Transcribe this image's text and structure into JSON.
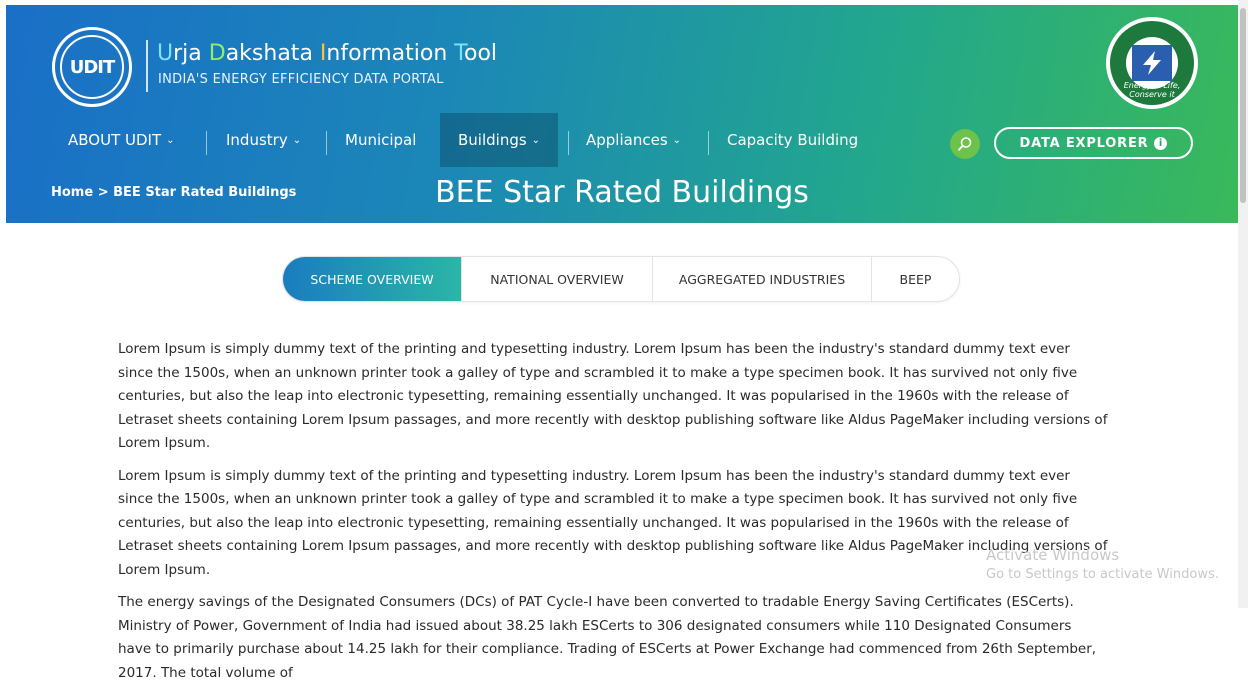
{
  "brand": {
    "logo_text": "UDIT",
    "title_parts": [
      {
        "cap": "U",
        "rest": "rja "
      },
      {
        "cap": "D",
        "rest": "akshata "
      },
      {
        "cap": "I",
        "rest": "nformation "
      },
      {
        "cap": "T",
        "rest": "ool"
      }
    ],
    "subtitle": "INDIA'S ENERGY EFFICIENCY DATA PORTAL",
    "bee_logo_text": "Energy is Life, Conserve it"
  },
  "nav": {
    "items": [
      {
        "label": "ABOUT UDIT",
        "dropdown": true
      },
      {
        "label": "Industry",
        "dropdown": true
      },
      {
        "label": "Municipal",
        "dropdown": false
      },
      {
        "label": "Buildings",
        "dropdown": true
      },
      {
        "label": "Appliances",
        "dropdown": true
      },
      {
        "label": "Capacity Building",
        "dropdown": false
      }
    ],
    "search_icon": "search-icon",
    "explorer_label": "DATA EXPLORER"
  },
  "breadcrumb": "Home > BEE Star Rated Buildings",
  "page_title": "BEE Star Rated Buildings",
  "tabs": [
    {
      "label": "SCHEME OVERVIEW",
      "active": true
    },
    {
      "label": "NATIONAL OVERVIEW",
      "active": false
    },
    {
      "label": "AGGREGATED INDUSTRIES",
      "active": false
    },
    {
      "label": "BEEP",
      "active": false
    }
  ],
  "paragraphs": [
    "Lorem Ipsum is simply dummy text of the printing and typesetting industry. Lorem Ipsum has been the industry's standard dummy text ever since the 1500s, when an unknown printer took a galley of type and scrambled it to make a type specimen book. It has survived not only five centuries, but also the leap into electronic typesetting, remaining essentially unchanged. It was popularised in the 1960s with the release of Letraset sheets containing Lorem Ipsum passages, and more recently with desktop publishing software like Aldus PageMaker including versions of Lorem Ipsum.",
    "Lorem Ipsum is simply dummy text of the printing and typesetting industry. Lorem Ipsum has been the industry's standard dummy text ever since the 1500s, when an unknown printer took a galley of type and scrambled it to make a type specimen book. It has survived not only five centuries, but also the leap into electronic typesetting, remaining essentially unchanged. It was popularised in the 1960s with the release of Letraset sheets containing Lorem Ipsum passages, and more recently with desktop publishing software like Aldus PageMaker including versions of Lorem Ipsum.",
    "The energy savings of the Designated Consumers (DCs) of PAT Cycle-I have been converted to tradable Energy Saving Certificates (ESCerts). Ministry of Power, Government of India had issued about 38.25 lakh ESCerts to 306 designated consumers while 110 Designated Consumers have to primarily purchase about 14.25 lakh for their compliance. Trading of ESCerts at Power Exchange had commenced from 26th September, 2017. The total volume of"
  ],
  "watermark": {
    "line1": "Activate Windows",
    "line2": "Go to Settings to activate Windows."
  }
}
